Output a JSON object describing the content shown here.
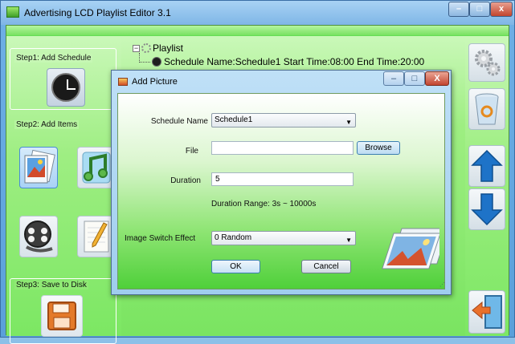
{
  "app": {
    "title": "Advertising LCD Playlist Editor 3.1",
    "caption_buttons": {
      "minimize": "–",
      "maximize": "□",
      "close": "x"
    }
  },
  "left_panel": {
    "step1_label": "Step1: Add Schedule",
    "step2_label": "Step2: Add Items",
    "step3_label": "Step3: Save to Disk"
  },
  "tree": {
    "root_expander": "−",
    "root_label": "Playlist",
    "schedule_label": "Schedule Name:Schedule1  Start Time:08:00  End Time:20:00"
  },
  "dialog": {
    "title": "Add Picture",
    "caption_buttons": {
      "minimize": "–",
      "maximize": "□",
      "close": "X"
    },
    "schedule_name_label": "Schedule Name",
    "schedule_name_value": "Schedule1",
    "file_label": "File",
    "file_value": "",
    "browse_label": "Browse",
    "duration_label": "Duration",
    "duration_value": "5",
    "duration_range": "Duration Range: 3s ~ 10000s",
    "effect_label": "Image Switch Effect",
    "effect_value": "0 Random",
    "ok_label": "OK",
    "cancel_label": "Cancel"
  },
  "colors": {
    "accent_green": "#3ec032",
    "title_blue": "#7fb6e6",
    "arrow_blue": "#1e73c8",
    "exit_orange": "#e9702a"
  },
  "icons": [
    "app-icon",
    "clock-icon",
    "picture-icon",
    "music-icon",
    "video-icon",
    "text-icon",
    "save-disk-icon",
    "settings-gears-icon",
    "recycle-bin-icon",
    "arrow-up-icon",
    "arrow-down-icon",
    "exit-door-icon",
    "playlist-icon",
    "schedule-icon",
    "photos-icon"
  ]
}
